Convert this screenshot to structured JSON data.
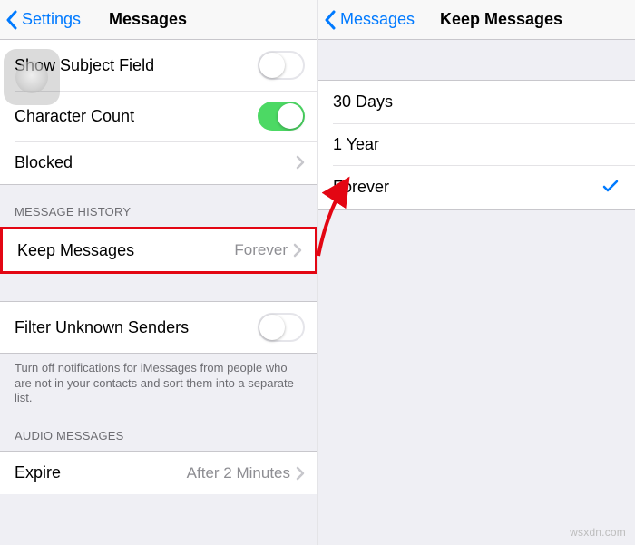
{
  "left": {
    "nav": {
      "back": "Settings",
      "title": "Messages"
    },
    "assistive_name": "assistive-touch",
    "cells": {
      "show_subject": {
        "label": "Show Subject Field",
        "on": false
      },
      "char_count": {
        "label": "Character Count",
        "on": true
      },
      "blocked": {
        "label": "Blocked"
      }
    },
    "history": {
      "header": "MESSAGE HISTORY",
      "keep_label": "Keep Messages",
      "keep_value": "Forever"
    },
    "filter": {
      "label": "Filter Unknown Senders",
      "on": false,
      "footer": "Turn off notifications for iMessages from people who are not in your contacts and sort them into a separate list."
    },
    "audio": {
      "header": "AUDIO MESSAGES",
      "expire_label": "Expire",
      "expire_value": "After 2 Minutes"
    }
  },
  "right": {
    "nav": {
      "back": "Messages",
      "title": "Keep Messages"
    },
    "options": [
      {
        "label": "30 Days",
        "selected": false
      },
      {
        "label": "1 Year",
        "selected": false
      },
      {
        "label": "Forever",
        "selected": true
      }
    ]
  },
  "watermark": "wsxdn.com"
}
